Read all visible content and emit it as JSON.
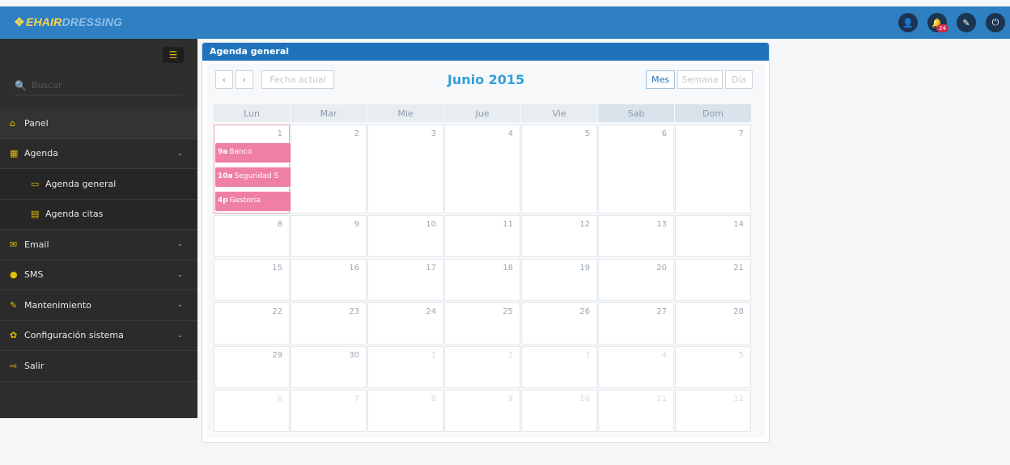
{
  "brand": {
    "part1": "EHAIR",
    "part2": "DRESSING"
  },
  "top_icons": {
    "notifications_count": "24"
  },
  "sidebar": {
    "search_placeholder": "Buscar",
    "items": [
      {
        "label": "Panel",
        "icon": "home-icon"
      },
      {
        "label": "Agenda",
        "icon": "calendar-icon",
        "expandable": true
      },
      {
        "label": "Agenda general",
        "icon": "calendar-icon",
        "sub": true
      },
      {
        "label": "Agenda citas",
        "icon": "calendar-icon",
        "sub": true
      },
      {
        "label": "Email",
        "icon": "envelope-icon",
        "expandable": true
      },
      {
        "label": "SMS",
        "icon": "chat-icon",
        "expandable": true
      },
      {
        "label": "Mantenimiento",
        "icon": "wrench-icon",
        "expandable": true
      },
      {
        "label": "Configuración sistema",
        "icon": "gear-icon",
        "expandable": true
      },
      {
        "label": "Salir",
        "icon": "sign-out-icon"
      }
    ]
  },
  "panel": {
    "title": "Agenda general"
  },
  "calendar": {
    "title": "Junio 2015",
    "today_label": "Fecha actual",
    "views": {
      "month": "Mes",
      "week": "Semana",
      "day": "Día"
    },
    "active_view": "Mes",
    "days_of_week": [
      "Lun",
      "Mar",
      "Mie",
      "Jue",
      "Vie",
      "Sab",
      "Dom"
    ],
    "weeks": [
      [
        "1",
        "2",
        "3",
        "4",
        "5",
        "6",
        "7"
      ],
      [
        "8",
        "9",
        "10",
        "11",
        "12",
        "13",
        "14"
      ],
      [
        "15",
        "16",
        "17",
        "18",
        "19",
        "20",
        "21"
      ],
      [
        "22",
        "23",
        "24",
        "25",
        "26",
        "27",
        "28"
      ],
      [
        "29",
        "30",
        "1",
        "2",
        "3",
        "4",
        "5"
      ],
      [
        "6",
        "7",
        "8",
        "9",
        "10",
        "11",
        "12"
      ]
    ],
    "events": [
      {
        "time": "9a",
        "title": "Banco"
      },
      {
        "time": "10a",
        "title": "Seguridad S"
      },
      {
        "time": "4p",
        "title": "Gestoria"
      }
    ]
  }
}
